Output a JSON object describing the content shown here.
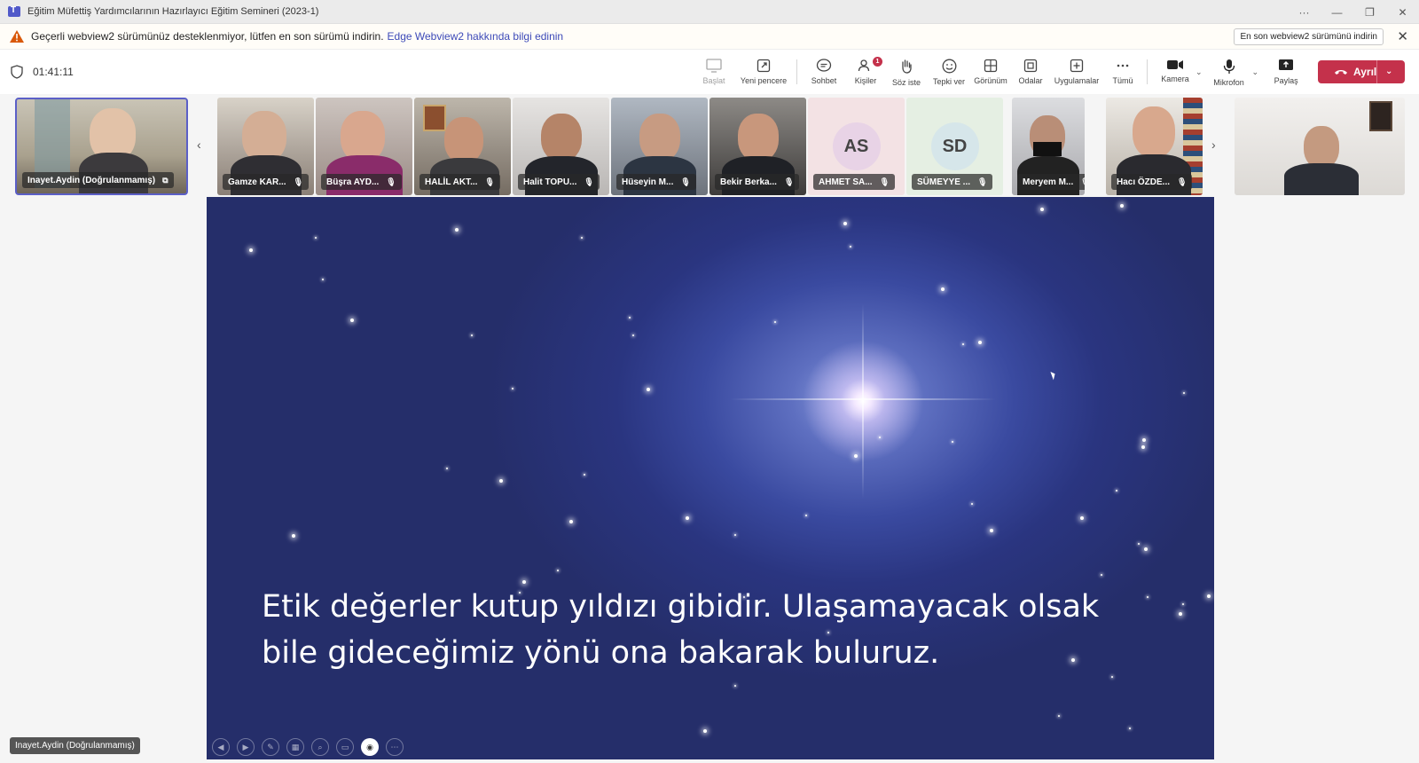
{
  "window": {
    "title": "Eğitim Müfettiş Yardımcılarının Hazırlayıcı Eğitim Semineri (2023-1)",
    "controls": [
      "···",
      "—",
      "❐",
      "✕"
    ]
  },
  "banner": {
    "message": "Geçerli webview2 sürümünüz desteklenmiyor, lütfen en son sürümü indirin.",
    "link": "Edge Webview2 hakkında bilgi edinin",
    "download_button": "En son webview2 sürümünü indirin",
    "close": "✕"
  },
  "meeting": {
    "timer": "01:41:11"
  },
  "toolbar": {
    "start": "Başlat",
    "new_window": "Yeni pencere",
    "chat": "Sohbet",
    "people": "Kişiler",
    "people_badge": "1",
    "raise_hand": "Söz iste",
    "react": "Tepki ver",
    "view": "Görünüm",
    "rooms": "Odalar",
    "apps": "Uygulamalar",
    "more": "Tümü",
    "camera": "Kamera",
    "microphone": "Mikrofon",
    "share": "Paylaş",
    "leave": "Ayrıl"
  },
  "participants": [
    {
      "name": "Inayet.Aydin (Doğrulanmamış)",
      "self": true
    },
    {
      "name": "Gamze KAR..."
    },
    {
      "name": "Büşra AYD..."
    },
    {
      "name": "HALİL AKT..."
    },
    {
      "name": "Halit TOPU..."
    },
    {
      "name": "Hüseyin M..."
    },
    {
      "name": "Bekir Berka..."
    },
    {
      "name": "AHMET SA...",
      "initials": "AS"
    },
    {
      "name": "SÜMEYYE ...",
      "initials": "SD"
    },
    {
      "name": "Meryem M..."
    },
    {
      "name": "Hacı ÖZDE..."
    },
    {
      "name": ""
    }
  ],
  "slide": {
    "quote_line1": "Etik değerler kutup yıldızı gibidir. Ulaşamayacak olsak",
    "quote_line2": "bile gideceğimiz yönü ona bakarak buluruz."
  },
  "presenter_tag": "Inayet.Aydin (Doğrulanmamış)",
  "colors": {
    "accent": "#5b5fc7",
    "leave": "#c4314b",
    "slide_bg": "#2a3580"
  }
}
